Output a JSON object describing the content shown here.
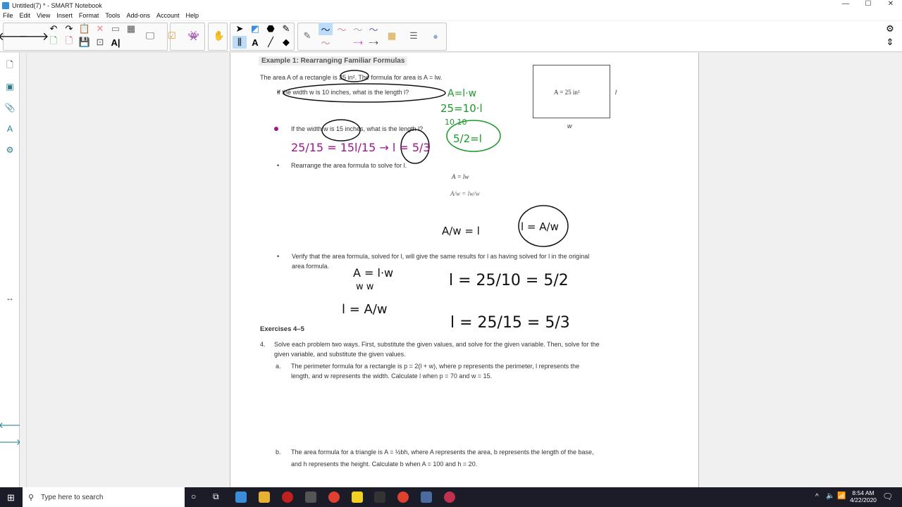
{
  "window": {
    "title": "Untitled(7) * - SMART Notebook",
    "controls": [
      "—",
      "☐",
      "✕"
    ]
  },
  "menu": [
    "File",
    "Edit",
    "View",
    "Insert",
    "Format",
    "Tools",
    "Add-ons",
    "Account",
    "Help"
  ],
  "toolbar": {
    "icons": [
      "back-arrow",
      "forward-arrow",
      "undo",
      "redo",
      "paste",
      "delete",
      "screen-shade",
      "table",
      "open",
      "save-as",
      "save",
      "full-screen",
      "text-properties",
      "screen-capture",
      "response",
      "monster",
      "hand",
      "select",
      "shapes",
      "fill",
      "magic-pen",
      "pens",
      "text",
      "line",
      "eraser",
      "pen",
      "pen-styles",
      "color-palette",
      "line-properties",
      "transparency",
      "settings"
    ]
  },
  "document": {
    "heading": "Example 1:  Rearranging Familiar Formulas",
    "intro": "The area A of a rectangle is 25 in². The formula for area is A = lw.",
    "bullet1": "If the width w is 10 inches, what is the length l?",
    "bullet2": "If the width w is 15 inches, what is the length l?",
    "bullet3": "Rearrange the area formula to solve for l.",
    "bullet4a": "Verify that the area formula, solved for l, will give the same results for l as having solved for l in the original",
    "bullet4b": "area formula.",
    "rect_label": "A = 25 in²",
    "rect_side": "l",
    "rect_bottom": "w",
    "formula1": "A = lw",
    "formula2": "A/w = lw/w",
    "exercises_heading": "Exercises 4–5",
    "ex4_num": "4.",
    "ex4_line1": "Solve each problem two ways.  First, substitute the given values, and solve for the given variable.  Then, solve for the",
    "ex4_line2": "given variable, and substitute the given values.",
    "exa_label": "a.",
    "exa_line1": "The perimeter formula for a rectangle is p = 2(l + w), where p represents the perimeter, l represents the",
    "exa_line2": "length, and w represents the width.  Calculate l when p = 70 and w = 15.",
    "exb_label": "b.",
    "exb_line1": "The area formula for a triangle is A = ½bh, where A represents the area, b represents the length of the base,",
    "exb_line2": "and h represents the height.  Calculate b when A = 100 and h = 20."
  },
  "ink": {
    "green": [
      "A=l·w",
      "25=10·l",
      "10   10",
      "5/2=l"
    ],
    "purple": [
      "25/15 = 15l/15 → l = 5/3"
    ],
    "black": [
      "A/w = l",
      "l = A/w",
      "A = l·w",
      "w    w",
      "l = A/w",
      "l = 25/10 = 5/2",
      "l = 25/15 = 5/3"
    ],
    "colors": {
      "green": "#1a9a2a",
      "purple": "#a0148c",
      "black": "#111111"
    }
  },
  "taskbar": {
    "search_placeholder": "Type here to search",
    "time": "8:54 AM",
    "date": "4/22/2020"
  }
}
